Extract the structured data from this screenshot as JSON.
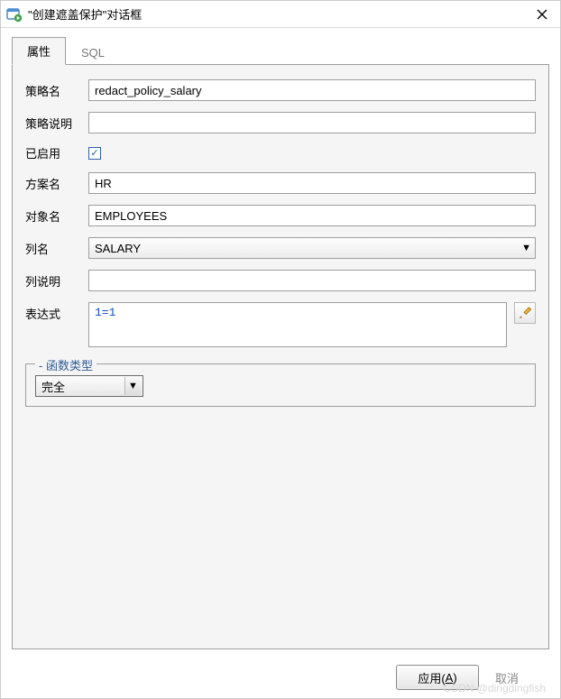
{
  "title": "\"创建遮盖保护\"对话框",
  "tabs": {
    "attributes": "属性",
    "sql": "SQL"
  },
  "form": {
    "policy_name_label": "策略名",
    "policy_name_value": "redact_policy_salary",
    "policy_desc_label": "策略说明",
    "policy_desc_value": "",
    "enabled_label": "已启用",
    "enabled_checked": "✓",
    "schema_label": "方案名",
    "schema_value": "HR",
    "object_label": "对象名",
    "object_value": "EMPLOYEES",
    "column_label": "列名",
    "column_value": "SALARY",
    "column_desc_label": "列说明",
    "column_desc_value": "",
    "expression_label": "表达式",
    "expression_value": "1=1"
  },
  "function_type": {
    "legend": "函数类型",
    "value": "完全"
  },
  "buttons": {
    "apply": "应用(",
    "apply_key": "A",
    "apply_suffix": ")",
    "cancel": "取消"
  },
  "watermark": "CSDN @dingdingfish"
}
